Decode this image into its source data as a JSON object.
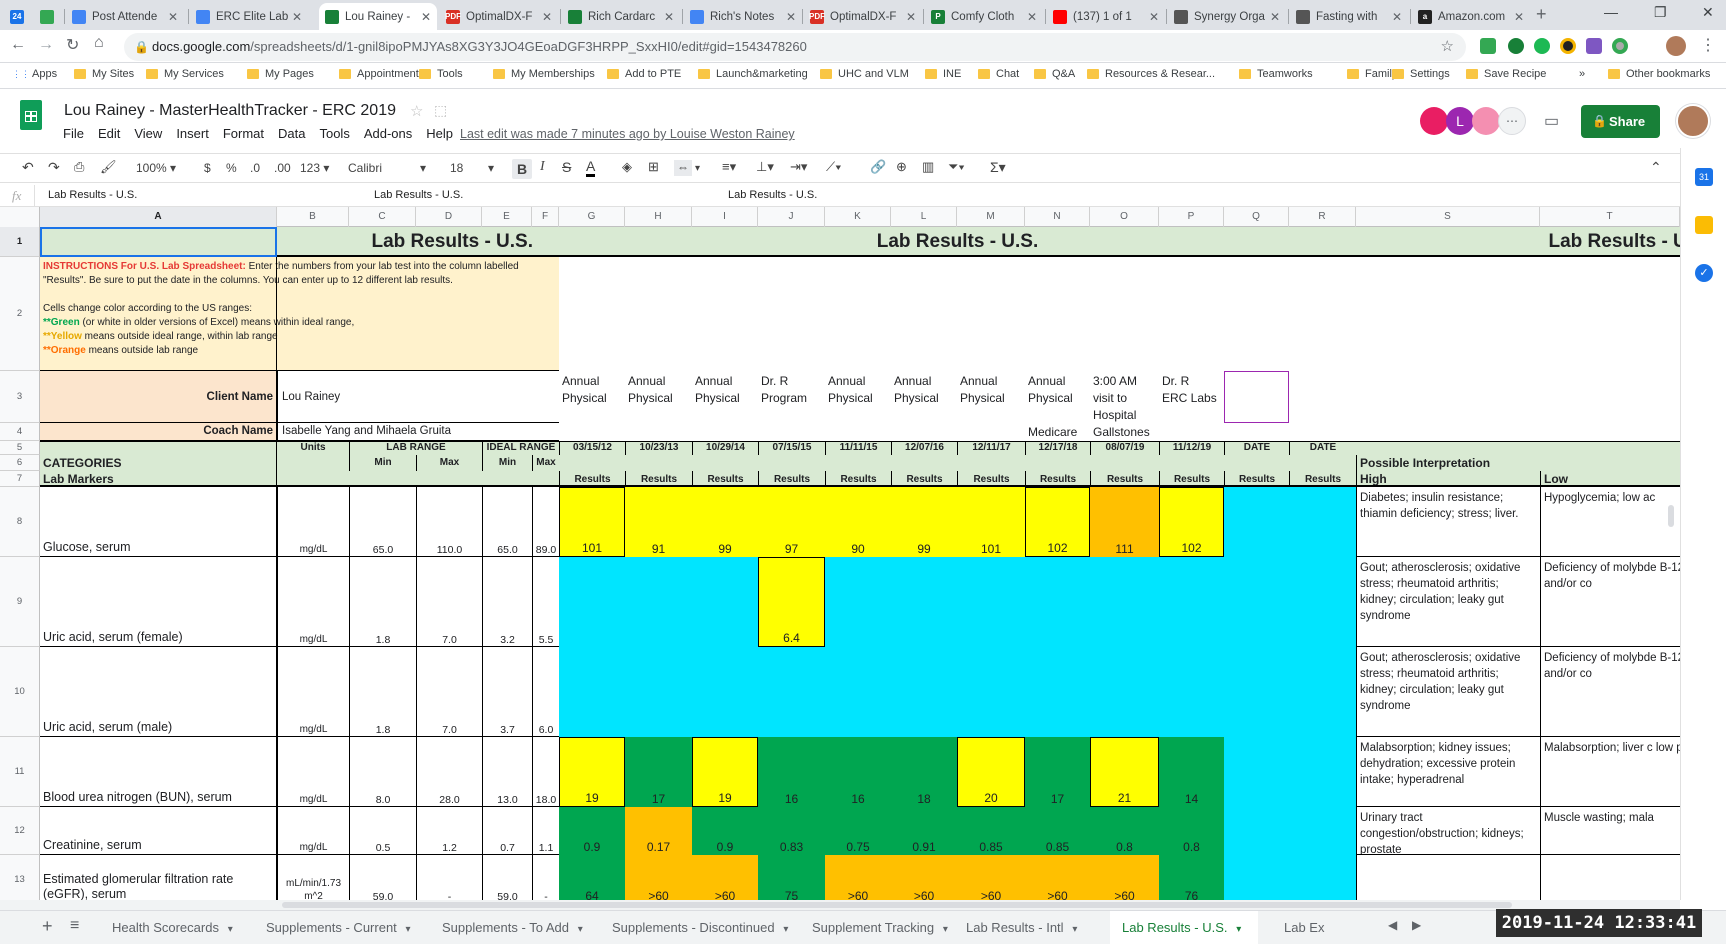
{
  "browser": {
    "tabs": [
      {
        "label": "",
        "fav": "24",
        "favColor": "#1a73e8"
      },
      {
        "label": "",
        "fav": "",
        "favColor": "#34a853"
      },
      {
        "label": "Post Attende",
        "fav": "",
        "favColor": "#4285f4"
      },
      {
        "label": "ERC Elite Lab",
        "fav": "",
        "favColor": "#4285f4"
      },
      {
        "label": "Lou Rainey -",
        "fav": "",
        "favColor": "#188038"
      },
      {
        "label": "OptimalDX-F",
        "fav": "PDF",
        "favColor": "#d93025"
      },
      {
        "label": "Rich Cardarc",
        "fav": "",
        "favColor": "#188038"
      },
      {
        "label": "Rich's Notes",
        "fav": "",
        "favColor": "#4285f4"
      },
      {
        "label": "OptimalDX-F",
        "fav": "PDF",
        "favColor": "#d93025"
      },
      {
        "label": "Comfy Cloth",
        "fav": "P",
        "favColor": "#188038"
      },
      {
        "label": "(137) 1 of 1",
        "fav": "",
        "favColor": "#ff0000"
      },
      {
        "label": "Synergy Orga",
        "fav": "",
        "favColor": "#555555"
      },
      {
        "label": "Fasting with",
        "fav": "",
        "favColor": "#555555"
      },
      {
        "label": "Amazon.com",
        "fav": "a",
        "favColor": "#222222"
      }
    ],
    "url_domain": "docs.google.com",
    "url_path": "/spreadsheets/d/1-gnil8ipoPMJYAs8XG3Y3JO4GEoaDGF3HRPP_SxxHI0/edit#gid=1543478260",
    "bookmarks": [
      "Apps",
      "My Sites",
      "My Services",
      "My Pages",
      "Appointments",
      "Tools",
      "My Memberships",
      "Add to PTE",
      "Launch&marketing",
      "UHC and VLM",
      "INE",
      "Chat",
      "Q&A",
      "Resources & Resear...",
      "Teamworks",
      "Family",
      "Settings",
      "Save Recipe",
      "»",
      "Other bookmarks"
    ]
  },
  "doc": {
    "title": "Lou Rainey - MasterHealthTracker - ERC 2019",
    "menu": [
      "File",
      "Edit",
      "View",
      "Insert",
      "Format",
      "Data",
      "Tools",
      "Add-ons",
      "Help"
    ],
    "last_edit": "Last edit was made 7 minutes ago by Louise Weston Rainey",
    "share_label": "Share",
    "avatars": [
      "",
      "L",
      "",
      ""
    ]
  },
  "toolbar": {
    "zoom": "100%",
    "currency": "$",
    "percent": "%",
    "dec_less": ".0",
    "dec_more": ".00",
    "format": "123",
    "font": "Calibri",
    "font_size": "18"
  },
  "formula_bar": {
    "fx": "fx",
    "value": "Lab Results - U.S.",
    "overflow1": "Lab Results - U.S.",
    "overflow2": "Lab Results - U.S."
  },
  "columns": [
    "A",
    "B",
    "C",
    "D",
    "E",
    "F",
    "G",
    "H",
    "I",
    "J",
    "K",
    "L",
    "M",
    "N",
    "O",
    "P",
    "Q",
    "R",
    "S",
    "T"
  ],
  "rows": [
    "1",
    "2",
    "3",
    "4",
    "5",
    "6",
    "7",
    "8",
    "9",
    "10",
    "11",
    "12",
    "13"
  ],
  "sheet": {
    "title": "Lab Results - U.S.",
    "instructions_title": "INSTRUCTIONS For U.S. Lab Spreadsheet:",
    "instructions_line1": " Enter the numbers from your lab test into the column labelled",
    "instructions_line2": "\"Results\".  Be sure to put the date in the columns.  You can enter up to 12 different lab results.",
    "instructions_line3": "Cells change color according to the US ranges:",
    "instructions_green": "**Green",
    "instructions_green_rest": " (or white in older versions of Excel) means within ideal range,",
    "instructions_yellow": "**Yellow",
    "instructions_yellow_rest": " means outside ideal range, within lab range",
    "instructions_orange": "**Orange",
    "instructions_orange_rest": " means outside lab range",
    "client_label": "Client Name",
    "client_value": "Lou Rainey",
    "coach_label": "Coach Name",
    "coach_value": "Isabelle Yang and Mihaela Gruita",
    "units_label": "Units",
    "lab_range_label": "LAB RANGE",
    "ideal_range_label": "IDEAL RANGE",
    "min_label": "Min",
    "max_label": "Max",
    "categories_label": "CATEGORIES",
    "markers_label": "Lab Markers",
    "results_label": "Results",
    "possible_label": "Possible Interpretation",
    "high_label": "High",
    "low_label": "Low",
    "test_headers": [
      {
        "line1": "Annual",
        "line2": "Physical",
        "line3": "",
        "line4": "",
        "date": "03/15/12"
      },
      {
        "line1": "Annual",
        "line2": "Physical",
        "line3": "",
        "line4": "",
        "date": "10/23/13"
      },
      {
        "line1": "Annual",
        "line2": "Physical",
        "line3": "",
        "line4": "",
        "date": "10/29/14"
      },
      {
        "line1": "Dr. R",
        "line2": "Program",
        "line3": "",
        "line4": "",
        "date": "07/15/15"
      },
      {
        "line1": "Annual",
        "line2": "Physical",
        "line3": "",
        "line4": "",
        "date": "11/11/15"
      },
      {
        "line1": "Annual",
        "line2": "Physical",
        "line3": "",
        "line4": "",
        "date": "12/07/16"
      },
      {
        "line1": "Annual",
        "line2": "Physical",
        "line3": "",
        "line4": "",
        "date": "12/11/17"
      },
      {
        "line1": "Annual",
        "line2": "Physical",
        "line3": "",
        "line4": "Medicare",
        "date": "12/17/18"
      },
      {
        "line1": "3:00 AM",
        "line2": "visit to",
        "line3": "Hospital",
        "line4": "Gallstones",
        "date": "08/07/19"
      },
      {
        "line1": "Dr. R",
        "line2": "ERC Labs",
        "line3": "",
        "line4": "",
        "date": "11/12/19"
      },
      {
        "line1": "",
        "line2": "",
        "line3": "",
        "line4": "",
        "date": "DATE"
      },
      {
        "line1": "",
        "line2": "",
        "line3": "",
        "line4": "",
        "date": "DATE"
      }
    ],
    "markers": [
      {
        "name": "Glucose, serum",
        "units": "mg/dL",
        "lab_min": "65.0",
        "lab_max": "110.0",
        "ideal_min": "65.0",
        "ideal_max": "89.0",
        "values": [
          "101",
          "91",
          "99",
          "97",
          "90",
          "99",
          "101",
          "102",
          "111",
          "102",
          "",
          ""
        ],
        "colors": [
          "y",
          "y",
          "y",
          "y",
          "y",
          "y",
          "y",
          "y",
          "o",
          "y",
          "c",
          "c"
        ],
        "high": "Diabetes; insulin resistance; thiamin deficiency; stress; liver.",
        "low": "Hypoglycemia; low ac"
      },
      {
        "name": "Uric acid, serum (female)",
        "units": "mg/dL",
        "lab_min": "1.8",
        "lab_max": "7.0",
        "ideal_min": "3.2",
        "ideal_max": "5.5",
        "values": [
          "",
          "",
          "",
          "6.4",
          "",
          "",
          "",
          "",
          "",
          "",
          "",
          ""
        ],
        "colors": [
          "c",
          "c",
          "c",
          "y",
          "c",
          "c",
          "c",
          "c",
          "c",
          "c",
          "c",
          "c"
        ],
        "high": "Gout; atherosclerosis; oxidative stress; rheumatoid arthritis; kidney; circulation; leaky gut syndrome",
        "low": "Deficiency of molybde B-12/folate and/or co"
      },
      {
        "name": "Uric acid, serum (male)",
        "units": "mg/dL",
        "lab_min": "1.8",
        "lab_max": "7.0",
        "ideal_min": "3.7",
        "ideal_max": "6.0",
        "values": [
          "",
          "",
          "",
          "",
          "",
          "",
          "",
          "",
          "",
          "",
          "",
          ""
        ],
        "colors": [
          "c",
          "c",
          "c",
          "c",
          "c",
          "c",
          "c",
          "c",
          "c",
          "c",
          "c",
          "c"
        ],
        "high": "Gout; atherosclerosis; oxidative stress; rheumatoid arthritis; kidney; circulation; leaky gut syndrome",
        "low": "Deficiency of molybde B-12/folate and/or co"
      },
      {
        "name": "Blood urea nitrogen (BUN), serum",
        "units": "mg/dL",
        "lab_min": "8.0",
        "lab_max": "28.0",
        "ideal_min": "13.0",
        "ideal_max": "18.0",
        "values": [
          "19",
          "17",
          "19",
          "16",
          "16",
          "18",
          "20",
          "17",
          "21",
          "14",
          "",
          ""
        ],
        "colors": [
          "y",
          "g",
          "y",
          "g",
          "g",
          "g",
          "y",
          "g",
          "y",
          "g",
          "c",
          "c"
        ],
        "high": "Malabsorption; kidney issues; dehydration; excessive protein intake; hyperadrenal",
        "low": "Malabsorption; liver c low protein diet"
      },
      {
        "name": "Creatinine, serum",
        "units": "mg/dL",
        "lab_min": "0.5",
        "lab_max": "1.2",
        "ideal_min": "0.7",
        "ideal_max": "1.1",
        "values": [
          "0.9",
          "0.17",
          "0.9",
          "0.83",
          "0.75",
          "0.91",
          "0.85",
          "0.85",
          "0.8",
          "0.8",
          "",
          ""
        ],
        "colors": [
          "g",
          "o",
          "g",
          "g",
          "g",
          "g",
          "g",
          "g",
          "g",
          "g",
          "c",
          "c"
        ],
        "high": "Urinary tract congestion/obstruction; kidneys; prostate",
        "low": "Muscle wasting; mala"
      },
      {
        "name": "Estimated glomerular filtration rate (eGFR), serum",
        "name1": "Estimated glomerular filtration rate",
        "name2": "(eGFR), serum",
        "units": "mL/min/1.73 m^2",
        "units1": "mL/min/1.73",
        "units2": "m^2",
        "lab_min": "59.0",
        "lab_max": "-",
        "ideal_min": "59.0",
        "ideal_max": "-",
        "values": [
          "64",
          ">60",
          ">60",
          "75",
          ">60",
          ">60",
          ">60",
          ">60",
          ">60",
          "76",
          "",
          ""
        ],
        "colors": [
          "g",
          "o",
          "o",
          "g",
          "o",
          "o",
          "o",
          "o",
          "o",
          "g",
          "c",
          "c"
        ],
        "high": "",
        "low": ""
      }
    ]
  },
  "colors": {
    "yellow": "#ffff00",
    "orange": "#ffc000",
    "green": "#00a650",
    "cyan": "#00e5ff",
    "header_green": "#d9ead3",
    "instr_bg": "#fff2cc",
    "label_peach": "#fce5cd",
    "accent": "#188038"
  },
  "sheet_tabs": [
    "Health Scorecards",
    "Supplements - Current",
    "Supplements - To Add",
    "Supplements - Discontinued",
    "Supplement Tracking",
    "Lab Results - Intl",
    "Lab Results - U.S.",
    "Lab Ex"
  ],
  "timestamp": "2019-11-24  12:33:41"
}
